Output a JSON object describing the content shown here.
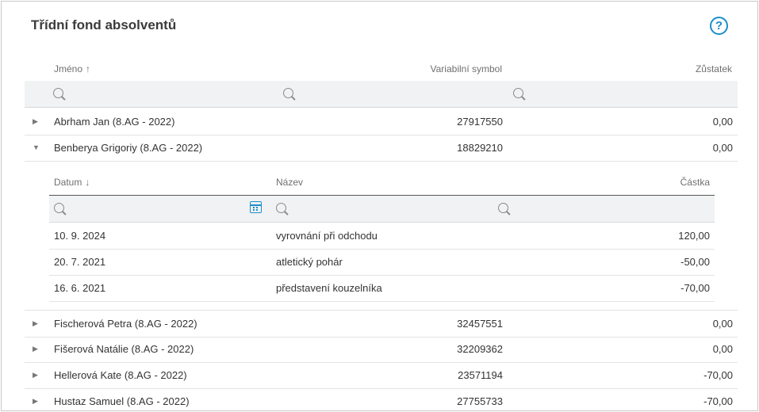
{
  "title": "Třídní fond absolventů",
  "help_label": "?",
  "columns": {
    "name": "Jméno",
    "name_sort": "↑",
    "vs": "Variabilní symbol",
    "balance": "Zůstatek"
  },
  "rows_top": [
    {
      "name": "Abrham Jan (8.AG - 2022)",
      "vs": "27917550",
      "balance": "0,00",
      "expanded": false
    },
    {
      "name": "Benberya Grigoriy (8.AG - 2022)",
      "vs": "18829210",
      "balance": "0,00",
      "expanded": true
    }
  ],
  "detail": {
    "columns": {
      "date": "Datum",
      "date_sort": "↓",
      "title": "Název",
      "amount": "Částka"
    },
    "rows": [
      {
        "date": "10. 9. 2024",
        "title": "vyrovnání při odchodu",
        "amount": "120,00"
      },
      {
        "date": "20. 7. 2021",
        "title": "atletický pohár",
        "amount": "-50,00"
      },
      {
        "date": "16. 6. 2021",
        "title": "představení kouzelníka",
        "amount": "-70,00"
      }
    ]
  },
  "rows_bottom": [
    {
      "name": "Fischerová Petra (8.AG - 2022)",
      "vs": "32457551",
      "balance": "0,00"
    },
    {
      "name": "Fišerová Natálie (8.AG - 2022)",
      "vs": "32209362",
      "balance": "0,00"
    },
    {
      "name": "Hellerová Kate (8.AG - 2022)",
      "vs": "23571194",
      "balance": "-70,00"
    },
    {
      "name": "Hustaz Samuel (8.AG - 2022)",
      "vs": "27755733",
      "balance": "-70,00"
    }
  ],
  "icons": {
    "expand_collapsed": "triangle-right-icon",
    "expand_open": "triangle-down-icon",
    "search": "search-icon",
    "calendar": "calendar-icon",
    "help": "help-icon"
  },
  "colors": {
    "accent": "#1a8fc9",
    "filter_bg": "#f1f2f3"
  }
}
